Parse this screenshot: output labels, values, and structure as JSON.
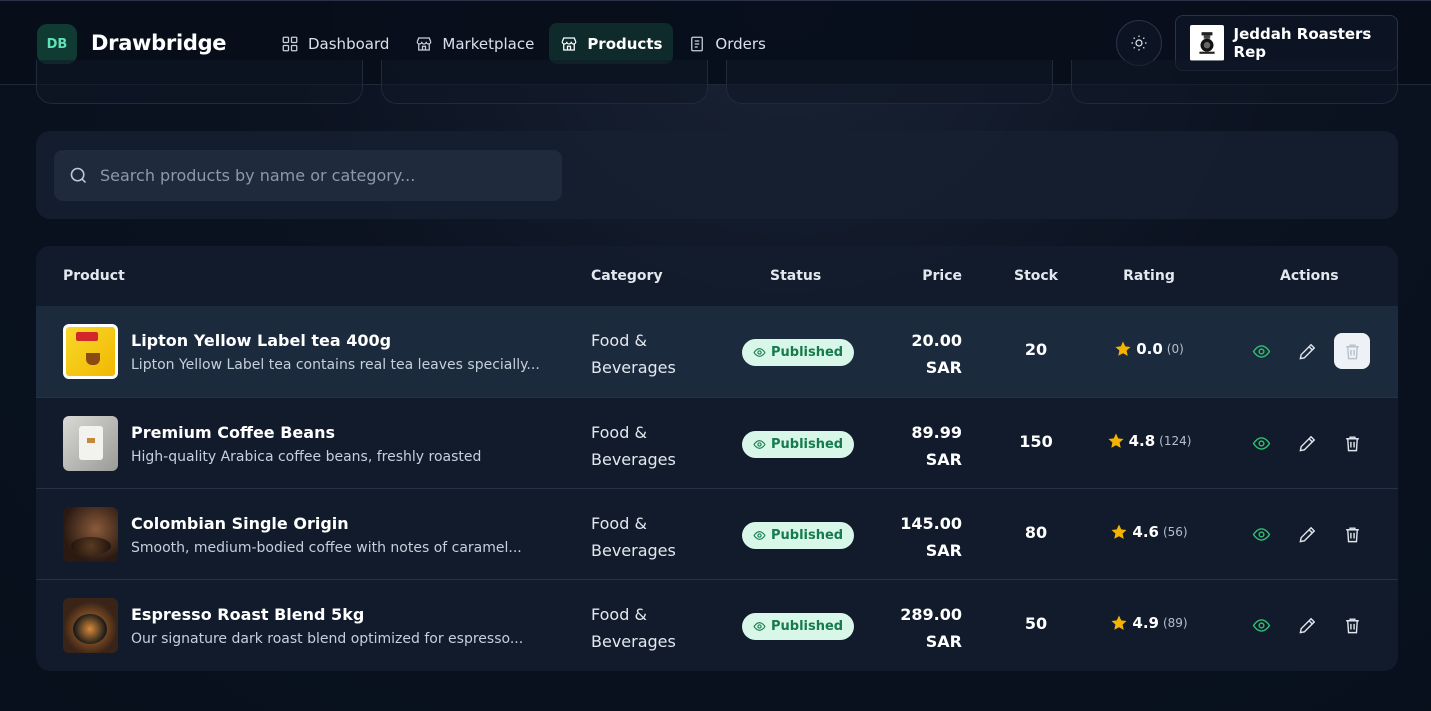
{
  "app": {
    "logo_text": "DB",
    "brand": "Drawbridge"
  },
  "nav": [
    {
      "label": "Dashboard",
      "icon": "dashboard-icon",
      "active": false
    },
    {
      "label": "Marketplace",
      "icon": "store-icon",
      "active": false
    },
    {
      "label": "Products",
      "icon": "store-icon",
      "active": true
    },
    {
      "label": "Orders",
      "icon": "document-icon",
      "active": false
    }
  ],
  "user": {
    "name": "Jeddah Roasters Rep"
  },
  "search": {
    "placeholder": "Search products by name or category..."
  },
  "table": {
    "headers": [
      "Product",
      "Category",
      "Status",
      "Price",
      "Stock",
      "Rating",
      "Actions"
    ],
    "rows": [
      {
        "name": "Lipton Yellow Label tea 400g",
        "description": "Lipton Yellow Label tea contains real tea leaves specially...",
        "category": "Food & Beverages",
        "status": "Published",
        "price": "20.00",
        "currency": "SAR",
        "stock": "20",
        "rating": "0.0",
        "rating_count": "(0)"
      },
      {
        "name": "Premium Coffee Beans",
        "description": "High-quality Arabica coffee beans, freshly roasted",
        "category": "Food & Beverages",
        "status": "Published",
        "price": "89.99",
        "currency": "SAR",
        "stock": "150",
        "rating": "4.8",
        "rating_count": "(124)"
      },
      {
        "name": "Colombian Single Origin",
        "description": "Smooth, medium-bodied coffee with notes of caramel...",
        "category": "Food & Beverages",
        "status": "Published",
        "price": "145.00",
        "currency": "SAR",
        "stock": "80",
        "rating": "4.6",
        "rating_count": "(56)"
      },
      {
        "name": "Espresso Roast Blend 5kg",
        "description": "Our signature dark roast blend optimized for espresso...",
        "category": "Food & Beverages",
        "status": "Published",
        "price": "289.00",
        "currency": "SAR",
        "stock": "50",
        "rating": "4.9",
        "rating_count": "(89)"
      }
    ]
  },
  "colors": {
    "accent": "#2fbf71",
    "star": "#f5b301",
    "badge_bg": "#d8f7e8",
    "badge_text": "#167a4e"
  }
}
